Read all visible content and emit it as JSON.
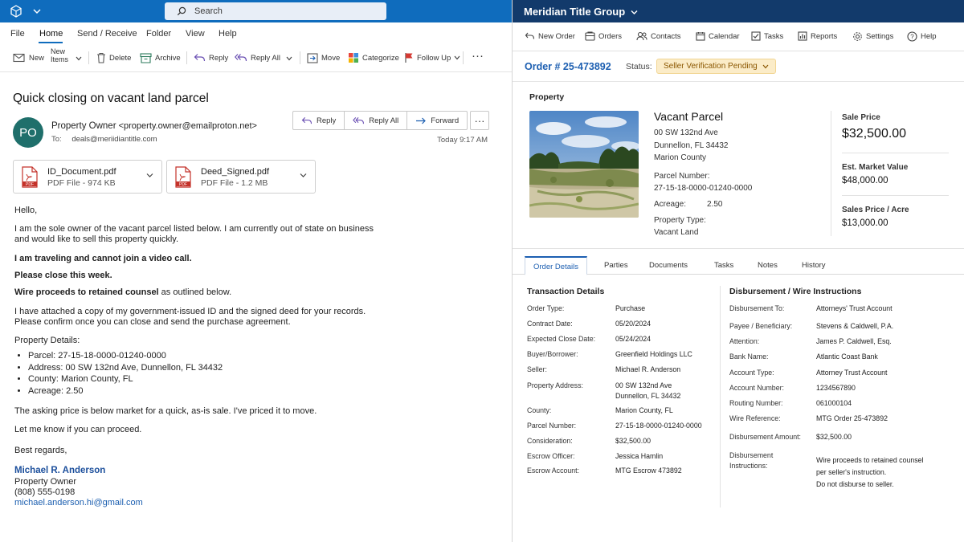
{
  "outlook": {
    "search_placeholder": "Search",
    "menu_tabs": [
      "File",
      "Home",
      "Send / Receive",
      "Folder",
      "View",
      "Help"
    ],
    "active_tab": "Home",
    "ribbon": {
      "new": "New",
      "new_items_line1": "New",
      "new_items_line2": "Items",
      "delete": "Delete",
      "archive": "Archive",
      "reply": "Reply",
      "reply_all": "Reply All",
      "move": "Move",
      "categorize": "Categorize",
      "follow_up": "Follow Up"
    },
    "message": {
      "subject": "Quick closing on vacant land parcel",
      "avatar_initials": "PO",
      "sender_name": "Property Owner",
      "sender_email": "<property.owner@emailproton.net>",
      "to_label": "To:",
      "to_address": "deals@meriidiantitle.com",
      "time": "Today 9:17 AM",
      "actions": {
        "reply": "Reply",
        "reply_all": "Reply All",
        "forward": "Forward"
      },
      "attachments": [
        {
          "name": "ID_Document.pdf",
          "meta": "PDF File - 974 KB"
        },
        {
          "name": "Deed_Signed.pdf",
          "meta": "PDF File - 1.2 MB"
        }
      ],
      "body": {
        "greeting": "Hello,",
        "para1_line1": "I am the sole owner of the vacant parcel listed below. I am currently out of state on business",
        "para1_line2": "and would like to sell this property quickly.",
        "bold1": "I am traveling and cannot join a video call.",
        "bold2": "Please close this week.",
        "bold3_bold": "Wire proceeds to retained counsel",
        "bold3_rest": " as outlined below.",
        "para2_line1": "I have attached a copy of my government-issued ID and the signed deed for your records.",
        "para2_line2": "Please confirm once you can close and send the purchase agreement.",
        "details_heading": "Property Details:",
        "details": [
          "Parcel: 27-15-18-0000-01240-0000",
          "Address: 00 SW 132nd Ave, Dunnellon, FL 34432",
          "County: Marion County, FL",
          "Acreage: 2.50"
        ],
        "para3": "The asking price is below market for a quick, as-is sale. I've priced it to move.",
        "para4": "Let me know if you can proceed.",
        "closing": "Best regards,",
        "sig_name": "Michael R. Anderson",
        "sig_title": "Property Owner",
        "sig_phone": "(808) 555-0198",
        "sig_email": "michael.anderson.hi@gmail.com"
      }
    }
  },
  "title_app": {
    "brand": "Meridian Title Group",
    "nav": [
      "New Order",
      "Orders",
      "Contacts",
      "Calendar",
      "Tasks",
      "Reports",
      "Settings",
      "Help"
    ],
    "order_number": "Order # 25-473892",
    "status_label": "Status:",
    "status_value": "Seller Verification Pending",
    "property": {
      "section_title": "Property",
      "name": "Vacant Parcel",
      "address1": "00 SW 132nd Ave",
      "address2": "Dunnellon, FL 34432",
      "county": "Marion County",
      "parcel_label": "Parcel Number:",
      "parcel_value": "27-15-18-0000-01240-0000",
      "acreage_label": "Acreage:",
      "acreage_value": "2.50",
      "type_label": "Property Type:",
      "type_value": "Vacant Land",
      "sale_price_label": "Sale Price",
      "sale_price_value": "$32,500.00",
      "market_value_label": "Est. Market Value",
      "market_value_value": "$48,000.00",
      "per_acre_label": "Sales Price / Acre",
      "per_acre_value": "$13,000.00"
    },
    "tabs": [
      "Order Details",
      "Parties",
      "Documents",
      "Tasks",
      "Notes",
      "History"
    ],
    "active_tab": "Order Details",
    "transaction": {
      "title": "Transaction Details",
      "rows": [
        {
          "label": "Order Type:",
          "value": "Purchase"
        },
        {
          "label": "Contract Date:",
          "value": "05/20/2024"
        },
        {
          "label": "Expected Close Date:",
          "value": "05/24/2024"
        },
        {
          "label": "Buyer/Borrower:",
          "value": "Greenfield Holdings LLC"
        },
        {
          "label": "Seller:",
          "value": "Michael R. Anderson"
        },
        {
          "label": "Property Address:",
          "value": "00 SW 132nd Ave",
          "value2": "Dunnellon, FL 34432"
        },
        {
          "label": "County:",
          "value": "Marion County, FL"
        },
        {
          "label": "Parcel Number:",
          "value": "27-15-18-0000-01240-0000"
        },
        {
          "label": "Consideration:",
          "value": "$32,500.00"
        },
        {
          "label": "Escrow Officer:",
          "value": "Jessica Hamlin"
        },
        {
          "label": "Escrow Account:",
          "value": "MTG Escrow 473892"
        }
      ]
    },
    "disbursement": {
      "title": "Disbursement / Wire Instructions",
      "rows": [
        {
          "label": "Disbursement To:",
          "value": "Attorneys' Trust Account"
        },
        {
          "label": "Payee / Beneficiary:",
          "value": "Stevens & Caldwell, P.A."
        },
        {
          "label": "Attention:",
          "value": "James P. Caldwell, Esq."
        },
        {
          "label": "Bank Name:",
          "value": "Atlantic Coast Bank"
        },
        {
          "label": "Account Type:",
          "value": "Attorney Trust Account"
        },
        {
          "label": "Account Number:",
          "value": "1234567890"
        },
        {
          "label": "Routing Number:",
          "value": "061000104"
        },
        {
          "label": "Wire Reference:",
          "value": "MTG Order 25-473892"
        },
        {
          "label": "Disbursement Amount:",
          "value": "$32,500.00"
        }
      ],
      "instructions_label1": "Disbursement",
      "instructions_label2": "Instructions:",
      "instructions_line1": "Wire proceeds to retained counsel",
      "instructions_line2": "per seller's instruction.",
      "instructions_line3": "Do not disburse to seller."
    }
  },
  "colors": {
    "outlook_blue": "#0f6cbd",
    "title_navy": "#123a6b",
    "link_blue": "#1d5fb1",
    "status_bg": "#fbecc8",
    "avatar": "#1f6f6b",
    "pdf_red": "#c4322a"
  },
  "icons": [
    "outlook-app-icon",
    "search-icon",
    "new-mail-icon",
    "delete-icon",
    "archive-icon",
    "reply-icon",
    "reply-all-icon",
    "move-icon",
    "categorize-icon",
    "flag-icon",
    "forward-icon",
    "pdf-icon",
    "new-order-icon",
    "orders-icon",
    "contacts-icon",
    "calendar-icon",
    "tasks-icon",
    "reports-icon",
    "settings-icon",
    "help-icon"
  ]
}
